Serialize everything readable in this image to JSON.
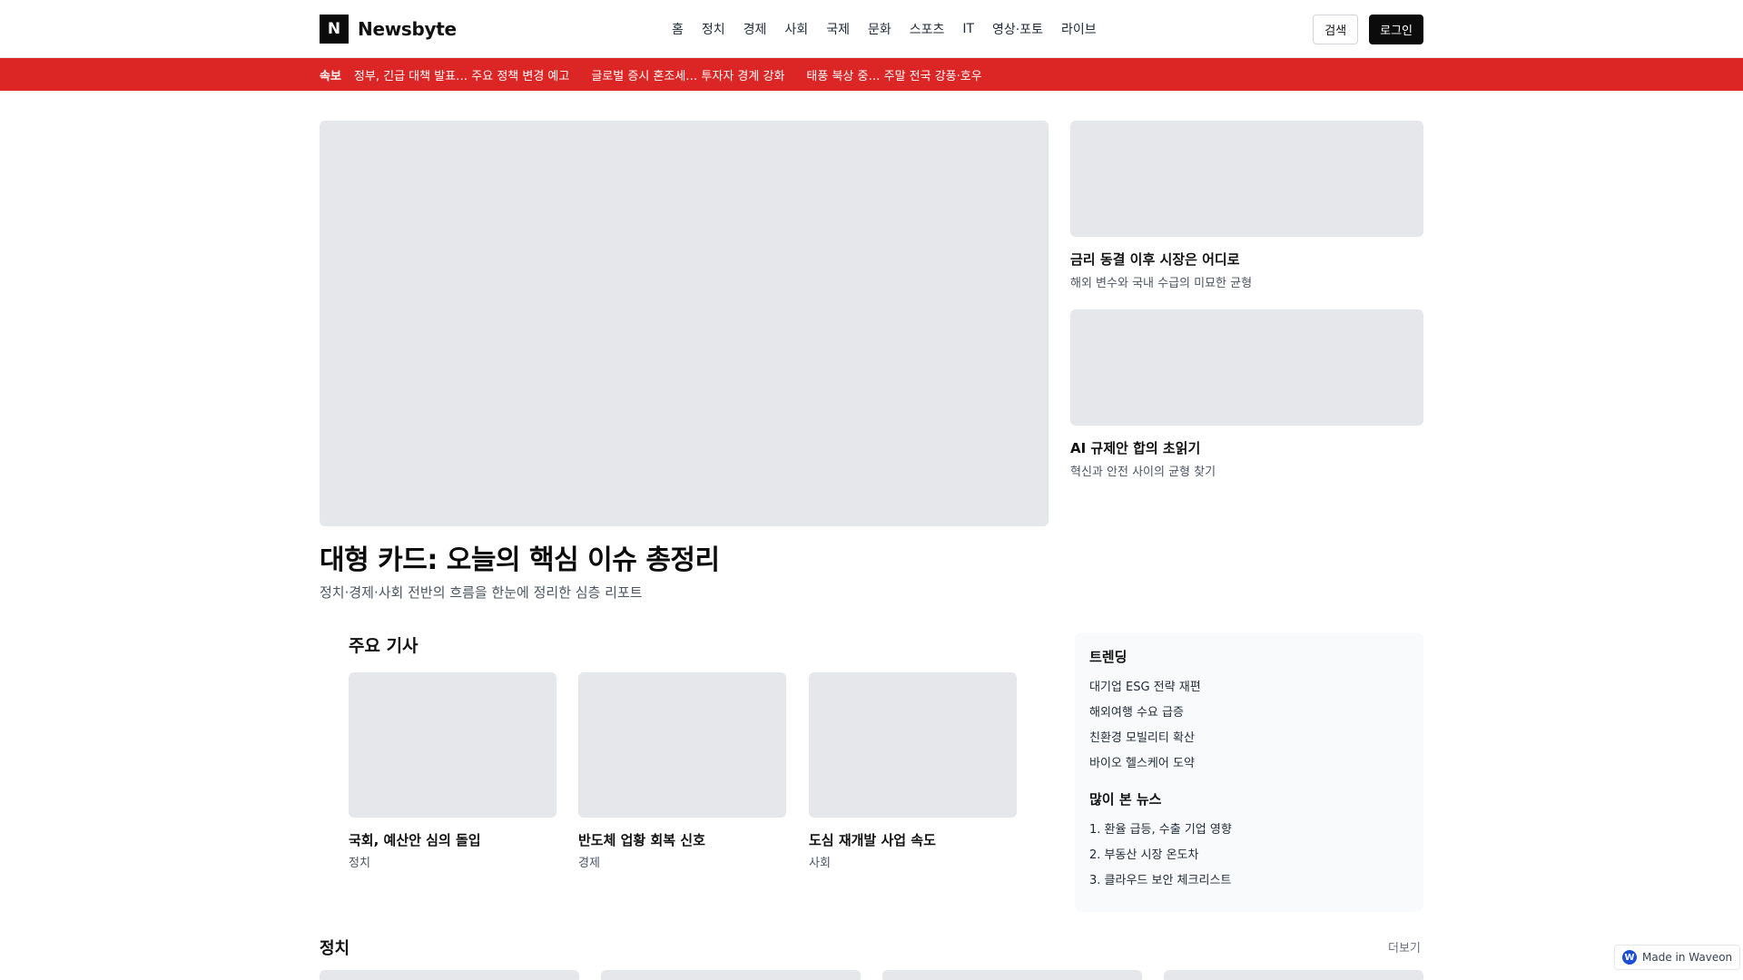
{
  "header": {
    "logo_mark": "N",
    "brand": "Newsbyte",
    "nav": [
      "홈",
      "정치",
      "경제",
      "사회",
      "국제",
      "문화",
      "스포츠",
      "IT",
      "영상·포토",
      "라이브"
    ],
    "search_label": "검색",
    "login_label": "로그인"
  },
  "ticker": {
    "label": "속보",
    "items": [
      "정부, 긴급 대책 발표… 주요 정책 변경 예고",
      "글로벌 증시 혼조세… 투자자 경계 강화",
      "태풍 북상 중… 주말 전국 강풍·호우"
    ]
  },
  "hero": {
    "title": "대형 카드: 오늘의 핵심 이슈 총정리",
    "subtitle": "정치·경제·사회 전반의 흐름을 한눈에 정리한 심층 리포트"
  },
  "side_cards": [
    {
      "title": "금리 동결 이후 시장은 어디로",
      "subtitle": "해외 변수와 국내 수급의 미묘한 균형"
    },
    {
      "title": "AI 규제안 합의 초읽기",
      "subtitle": "혁신과 안전 사이의 균형 찾기"
    }
  ],
  "top_stories": {
    "heading": "주요 기사",
    "items": [
      {
        "title": "국회, 예산안 심의 돌입",
        "category": "정치"
      },
      {
        "title": "반도체 업황 회복 신호",
        "category": "경제"
      },
      {
        "title": "도심 재개발 사업 속도",
        "category": "사회"
      }
    ]
  },
  "sidebar": {
    "trending_heading": "트렌딩",
    "trending": [
      "대기업 ESG 전략 재편",
      "해외여행 수요 급증",
      "친환경 모빌리티 확산",
      "바이오 헬스케어 도약"
    ],
    "popular_heading": "많이 본 뉴스",
    "popular": [
      "1. 환율 급등, 수출 기업 영향",
      "2. 부동산 시장 온도차",
      "3. 클라우드 보안 체크리스트"
    ]
  },
  "politics_section": {
    "heading": "정치",
    "more_label": "더보기"
  },
  "badge": {
    "icon": "waveon-logo-icon",
    "mark": "W",
    "label": "Made in Waveon"
  },
  "colors": {
    "ticker_bg": "#dc2626",
    "placeholder": "#e5e7eb",
    "dark": "#0b0b0b"
  }
}
